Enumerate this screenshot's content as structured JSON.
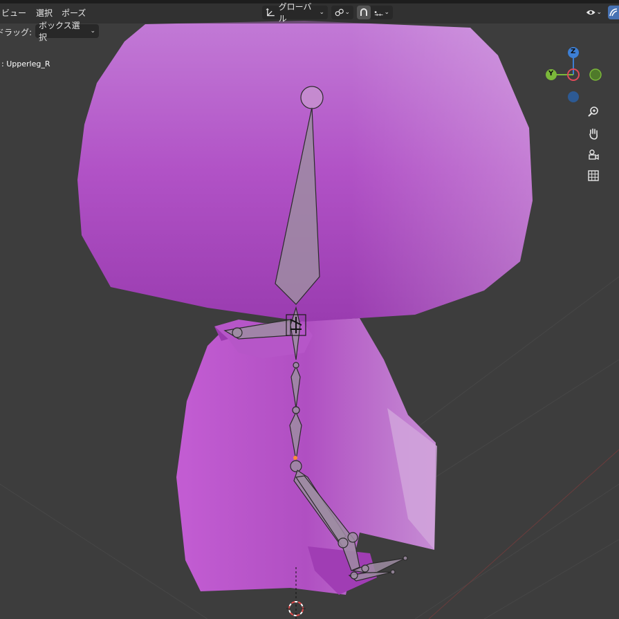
{
  "menu": {
    "view": "ビュー",
    "select": "選択",
    "pose": "ポーズ"
  },
  "header": {
    "transform_orientation": "グローバル"
  },
  "tool_settings": {
    "drag_label": "ドラッグ:",
    "drag_mode": "ボックス選択"
  },
  "viewport": {
    "active_bone": ": Upperleg_R"
  },
  "gizmo": {
    "z_label": "Z",
    "y_label": "Y"
  },
  "colors": {
    "background": "#3d3d3d",
    "mesh": "#b45ac4",
    "axis_x": "#e04a5a",
    "axis_y": "#7bb83a",
    "axis_z": "#3d7fd4",
    "header_bg": "#282828"
  },
  "icons": [
    "transform-orientation-icon",
    "pivot-link-icon",
    "snap-icon",
    "snap-increment-icon",
    "visibility-eye-icon",
    "overlay-icon",
    "zoom-icon",
    "pan-hand-icon",
    "camera-icon",
    "grid-ortho-icon",
    "cursor-3d-icon"
  ]
}
